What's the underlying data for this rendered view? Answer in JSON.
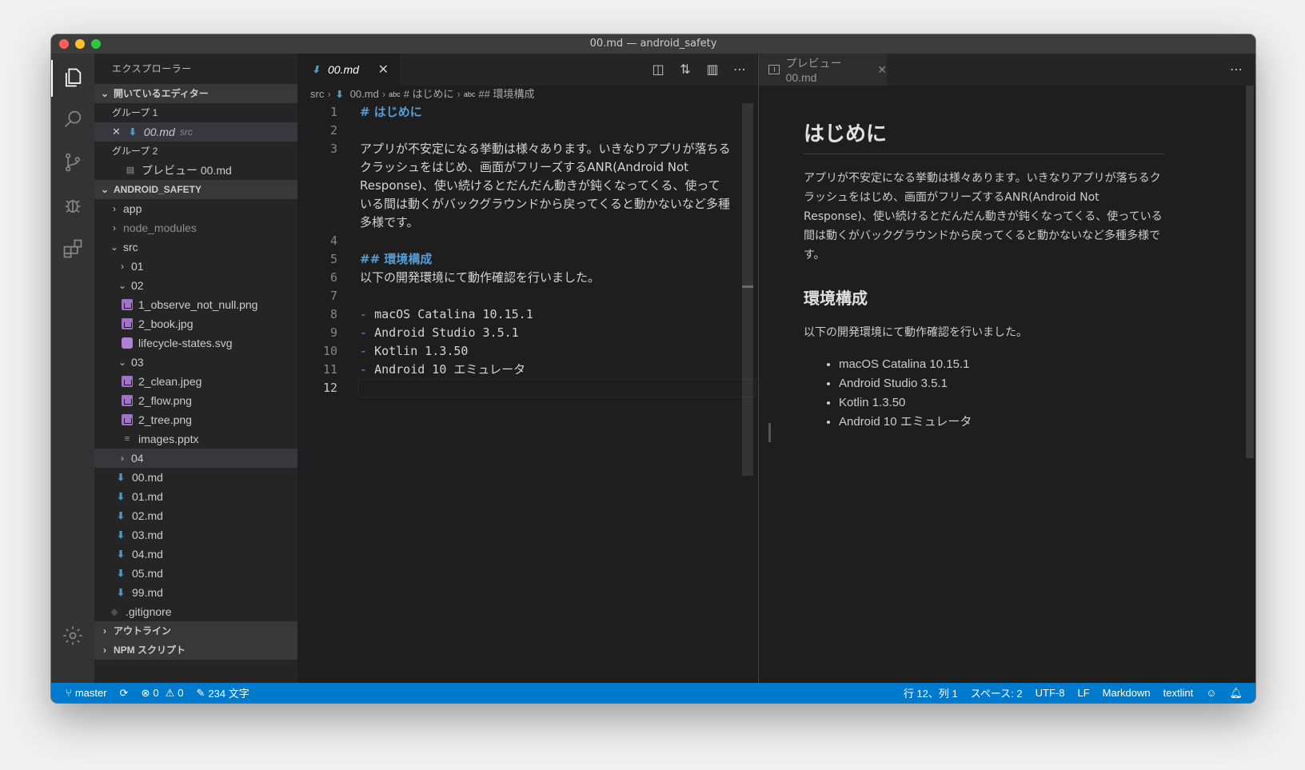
{
  "window": {
    "title": "00.md — android_safety"
  },
  "sidebar": {
    "title": "エクスプローラー",
    "open_editors_header": "開いているエディター",
    "group1": "グループ 1",
    "group1_file": "00.md",
    "group1_file_path": "src",
    "group2": "グループ 2",
    "group2_file": "プレビュー 00.md",
    "project_header": "ANDROID_SAFETY",
    "tree": {
      "app": "app",
      "node_modules": "node_modules",
      "src": "src",
      "f01": "01",
      "f02": "02",
      "f02_1": "1_observe_not_null.png",
      "f02_2": "2_book.jpg",
      "f02_3": "lifecycle-states.svg",
      "f03": "03",
      "f03_1": "2_clean.jpeg",
      "f03_2": "2_flow.png",
      "f03_3": "2_tree.png",
      "f03_4": "images.pptx",
      "f04": "04",
      "md00": "00.md",
      "md01": "01.md",
      "md02": "02.md",
      "md03": "03.md",
      "md04": "04.md",
      "md05": "05.md",
      "md99": "99.md",
      "gitignore": ".gitignore"
    },
    "outline_header": "アウトライン",
    "npm_header": "NPM スクリプト"
  },
  "editor": {
    "tab_label": "00.md",
    "breadcrumb": {
      "src": "src",
      "file": "00.md",
      "h1": "# はじめに",
      "h2": "## 環境構成",
      "abc": "abc"
    },
    "lines": {
      "n1": "1",
      "l1": "# はじめに",
      "n2": "2",
      "n3": "3",
      "l3a": "アプリが不安定になる挙動は様々あります。いきなりアプリが落ちる",
      "l3b": "クラッシュをはじめ、画面がフリーズするANR(Android Not",
      "l3c": "Response)、使い続けるとだんだん動きが鈍くなってくる、使って",
      "l3d": "いる間は動くがバックグラウンドから戻ってくると動かないなど多種",
      "l3e": "多様です。",
      "n4": "4",
      "n5": "5",
      "l5": "## 環境構成",
      "n6": "6",
      "l6": "以下の開発環境にて動作確認を行いました。",
      "n7": "7",
      "n8": "8",
      "l8": "macOS Catalina 10.15.1",
      "n9": "9",
      "l9": "Android Studio 3.5.1",
      "n10": "10",
      "l10": "Kotlin 1.3.50",
      "n11": "11",
      "l11": "Android 10 エミュレータ",
      "n12": "12",
      "bullet": "-"
    }
  },
  "preview": {
    "tab_label": "プレビュー 00.md",
    "h1": "はじめに",
    "p1": "アプリが不安定になる挙動は様々あります。いきなりアプリが落ちるクラッシュをはじめ、画面がフリーズするANR(Android Not Response)、使い続けるとだんだん動きが鈍くなってくる、使っている間は動くがバックグラウンドから戻ってくると動かないなど多種多様です。",
    "h2": "環境構成",
    "p2": "以下の開発環境にて動作確認を行いました。",
    "items": [
      "macOS Catalina 10.15.1",
      "Android Studio 3.5.1",
      "Kotlin 1.3.50",
      "Android 10 エミュレータ"
    ]
  },
  "status": {
    "branch": "master",
    "errors": "0",
    "warnings": "0",
    "words": "234 文字",
    "position": "行 12、列 1",
    "spaces": "スペース: 2",
    "encoding": "UTF-8",
    "eol": "LF",
    "language": "Markdown",
    "linter": "textlint"
  },
  "colors": {
    "accent": "#007acc",
    "heading": "#569cd6",
    "md_icon": "#519aba"
  }
}
